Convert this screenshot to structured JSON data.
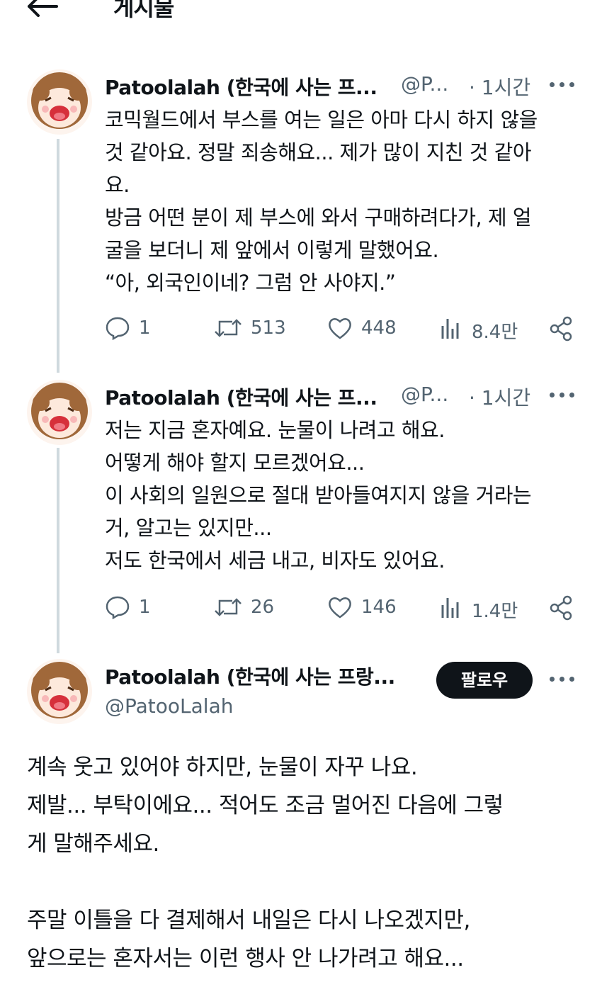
{
  "header": {
    "title": "게시물"
  },
  "colors": {
    "text": "#0f1419",
    "muted": "#536471",
    "thread_line": "#cfd9de",
    "follow_bg": "#0f1419"
  },
  "tweets": [
    {
      "name": "Patoolalah (한국에 사는 프...",
      "handle": "@P...",
      "time": "· 1시간",
      "lines": [
        "코믹월드에서 부스를 여는 일은 아마 다시 하지 않을",
        "것 같아요. 정말 죄송해요... 제가 많이 지친 것 같아",
        "요.",
        "방금 어떤 분이 제 부스에 와서 구매하려다가, 제 얼",
        "굴을 보더니 제 앞에서 이렇게 말했어요.",
        "“아, 외국인이네? 그럼 안 사야지.”"
      ],
      "replies": "1",
      "retweets": "513",
      "likes": "448",
      "views": "8.4만"
    },
    {
      "name": "Patoolalah (한국에 사는 프...",
      "handle": "@P...",
      "time": "· 1시간",
      "lines": [
        "저는 지금 혼자예요. 눈물이 나려고 해요.",
        "어떻게 해야 할지 모르겠어요...",
        "이 사회의 일원으로 절대 받아들여지지 않을 거라는",
        "거, 알고는 있지만...",
        "저도 한국에서 세금 내고, 비자도 있어요."
      ],
      "replies": "1",
      "retweets": "26",
      "likes": "146",
      "views": "1.4만"
    }
  ],
  "main_tweet": {
    "name": "Patoolalah (한국에 사는 프랑...",
    "handle": "@PatooLalah",
    "follow_label": "팔로우",
    "lines": [
      "계속 웃고 있어야 하지만, 눈물이 자꾸 나요.",
      "제발... 부탁이에요... 적어도 조금 멀어진 다음에 그렇",
      "게 말해주세요.",
      "",
      "주말 이틀을 다 결제해서 내일은 다시 나오겠지만,",
      "앞으로는 혼자서는 이런 행사 안 나가려고 해요..."
    ]
  }
}
